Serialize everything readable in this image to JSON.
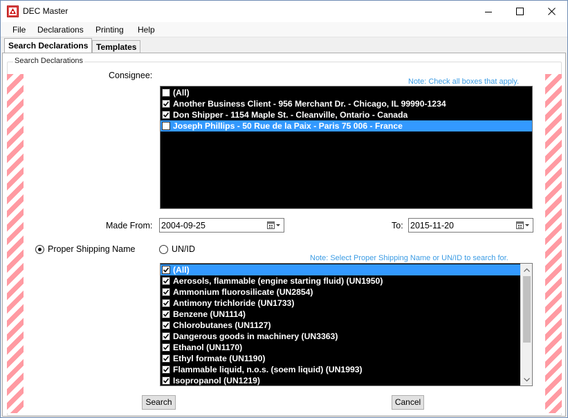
{
  "window": {
    "title": "DEC Master"
  },
  "menu": [
    "File",
    "Declarations",
    "Printing",
    "Help"
  ],
  "tabs": [
    {
      "label": "Search Declarations",
      "active": true
    },
    {
      "label": "Templates",
      "active": false
    }
  ],
  "group_title": "Search Declarations",
  "consignee": {
    "label": "Consignee:",
    "note": "Note: Check all boxes that apply.",
    "items": [
      {
        "label": "(All)",
        "checked": false,
        "selected": false
      },
      {
        "label": "Another Business Client - 956 Merchant Dr. - Chicago, IL 99990-1234",
        "checked": true,
        "selected": false
      },
      {
        "label": "Don Shipper - 1154 Maple St. - Cleanville, Ontario - Canada",
        "checked": true,
        "selected": false
      },
      {
        "label": "Joseph Phillips - 50 Rue de la Paix - Paris 75 006 - France",
        "checked": false,
        "selected": true
      }
    ]
  },
  "date_range": {
    "from_label": "Made From:",
    "from_value": "2004-09-25",
    "to_label": "To:",
    "to_value": "2015-11-20"
  },
  "search_mode": {
    "options": [
      {
        "label": "Proper Shipping Name",
        "checked": true
      },
      {
        "label": "UN/ID",
        "checked": false
      }
    ],
    "note": "Note: Select Proper Shipping Name or UN/ID to search for."
  },
  "shipping_names": [
    {
      "label": "(All)",
      "checked": true,
      "selected": true
    },
    {
      "label": "Aerosols, flammable (engine starting fluid) (UN1950)",
      "checked": true,
      "selected": false
    },
    {
      "label": "Ammonium fluorosilicate (UN2854)",
      "checked": true,
      "selected": false
    },
    {
      "label": "Antimony trichloride (UN1733)",
      "checked": true,
      "selected": false
    },
    {
      "label": "Benzene (UN1114)",
      "checked": true,
      "selected": false
    },
    {
      "label": "Chlorobutanes (UN1127)",
      "checked": true,
      "selected": false
    },
    {
      "label": "Dangerous goods in machinery (UN3363)",
      "checked": true,
      "selected": false
    },
    {
      "label": "Ethanol (UN1170)",
      "checked": true,
      "selected": false
    },
    {
      "label": "Ethyl formate (UN1190)",
      "checked": true,
      "selected": false
    },
    {
      "label": "Flammable liquid, n.o.s. (soem liquid) (UN1993)",
      "checked": true,
      "selected": false
    },
    {
      "label": "Isopropanol (UN1219)",
      "checked": true,
      "selected": false
    }
  ],
  "buttons": {
    "search": "Search",
    "cancel": "Cancel"
  },
  "colors": {
    "selection": "#3399ff",
    "note": "#3c9ce4",
    "stripe": "#ff9aa2",
    "list_bg": "#000000"
  }
}
